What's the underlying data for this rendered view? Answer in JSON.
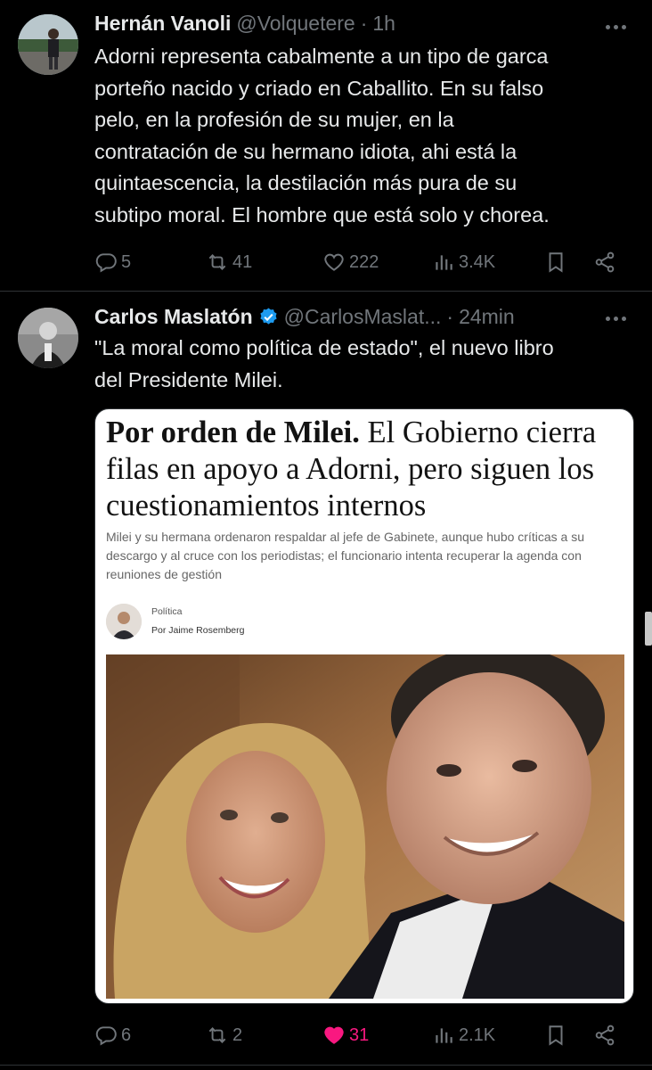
{
  "tweets": [
    {
      "name": "Hernán Vanoli",
      "handle": "@Volquetere",
      "separator": "·",
      "time": "1h",
      "text": "Adorni representa cabalmente a un tipo de garca\nporteño nacido y criado en Caballito. En su falso\npelo, en la profesión de su mujer, en la\ncontratación de su hermano idiota, ahi está la\nquintaescencia, la destilación más pura de su\nsubtipo moral. El hombre que está solo y chorea.",
      "replies": "5",
      "reposts": "41",
      "likes": "222",
      "views": "3.4K",
      "liked": false
    },
    {
      "name": "Carlos Maslatón",
      "verified": true,
      "handle": "@CarlosMaslat...",
      "separator": "·",
      "time": "24min",
      "text": "\"La moral como política de estado\", el nuevo libro\ndel Presidente Milei.",
      "replies": "6",
      "reposts": "2",
      "likes": "31",
      "views": "2.1K",
      "liked": true,
      "media": {
        "headline_bold": "Por orden de Milei.",
        "headline_rest": " El Gobierno cierra filas en apoyo a Adorni, pero siguen los cuestionamientos internos",
        "summary": "Milei y su hermana ordenaron respaldar al jefe de Gabinete, aunque hubo críticas a su descargo y al cruce con los periodistas; el funcionario intenta recuperar la agenda con reuniones de gestión",
        "section": "Política",
        "byline": "Por Jaime Rosemberg"
      }
    }
  ],
  "colors": {
    "background": "#000000",
    "text": "#e7e9ea",
    "muted": "#71767b",
    "like_active": "#f91880",
    "verified": "#1d9bf0",
    "divider": "#2f3336"
  },
  "icons": [
    "more-icon",
    "reply-icon",
    "repost-icon",
    "like-icon",
    "views-icon",
    "bookmark-icon",
    "share-icon",
    "verified-icon"
  ]
}
